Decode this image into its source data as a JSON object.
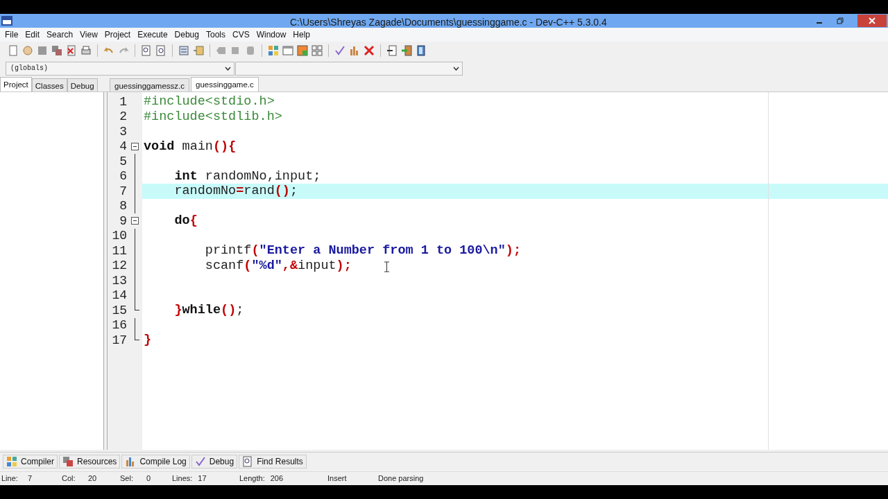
{
  "window": {
    "title": "C:\\Users\\Shreyas Zagade\\Documents\\guessinggame.c - Dev-C++ 5.3.0.4"
  },
  "menu": [
    "File",
    "Edit",
    "Search",
    "View",
    "Project",
    "Execute",
    "Debug",
    "Tools",
    "CVS",
    "Window",
    "Help"
  ],
  "scope_combos": [
    {
      "value": "(globals)"
    }
  ],
  "side_tabs": [
    {
      "label": "Project",
      "selected": true
    },
    {
      "label": "Classes",
      "selected": false
    },
    {
      "label": "Debug",
      "selected": false
    }
  ],
  "file_tabs": [
    {
      "label": "guessinggamessz.c",
      "selected": false
    },
    {
      "label": "guessinggame.c",
      "selected": true
    }
  ],
  "editor": {
    "lines": [
      {
        "number": "1",
        "selected": false,
        "kind": "plain",
        "tokens": [
          {
            "kind": "pre",
            "text": "#include<stdio.h>"
          }
        ]
      },
      {
        "number": "2",
        "selected": false,
        "kind": "plain",
        "tokens": [
          {
            "kind": "pre",
            "text": "#include<stdlib.h>"
          }
        ]
      },
      {
        "number": "3",
        "selected": false,
        "kind": "plain"
      },
      {
        "number": "4",
        "selected": false,
        "kind": "fold_start",
        "tokens": [
          {
            "kind": "kw",
            "text": "void"
          },
          {
            "kind": "id",
            "text": " main"
          },
          {
            "kind": "sym",
            "text": "(){"
          }
        ]
      },
      {
        "number": "5",
        "selected": false,
        "kind": "fold_line"
      },
      {
        "number": "6",
        "selected": false,
        "kind": "fold_line",
        "tokens": [
          {
            "kind": "kw",
            "text": "    int"
          },
          {
            "kind": "id",
            "text": " randomNo,input;"
          }
        ]
      },
      {
        "number": "7",
        "selected": true,
        "kind": "fold_line",
        "tokens": [
          {
            "kind": "id",
            "text": "    randomNo"
          },
          {
            "kind": "sym",
            "text": "="
          },
          {
            "kind": "id",
            "text": "rand"
          },
          {
            "kind": "sym",
            "text": "()"
          },
          {
            "kind": "id",
            "text": ";"
          }
        ]
      },
      {
        "number": "8",
        "selected": false,
        "kind": "fold_line"
      },
      {
        "number": "9",
        "selected": false,
        "kind": "fold_start",
        "tokens": [
          {
            "kind": "kw",
            "text": "    do"
          },
          {
            "kind": "sym",
            "text": "{"
          }
        ]
      },
      {
        "number": "10",
        "selected": false,
        "kind": "fold_line"
      },
      {
        "number": "11",
        "selected": false,
        "kind": "fold_line",
        "tokens": [
          {
            "kind": "id",
            "text": "        printf"
          },
          {
            "kind": "sym",
            "text": "("
          },
          {
            "kind": "str",
            "text": "\"Enter a Number from 1 to 100\\n\""
          },
          {
            "kind": "sym",
            "text": ");"
          }
        ]
      },
      {
        "number": "12",
        "selected": false,
        "kind": "fold_line",
        "tokens": [
          {
            "kind": "id",
            "text": "        scanf"
          },
          {
            "kind": "sym",
            "text": "("
          },
          {
            "kind": "str",
            "text": "\"%d\""
          },
          {
            "kind": "sym",
            "text": ",&"
          },
          {
            "kind": "id",
            "text": "input"
          },
          {
            "kind": "sym",
            "text": ");"
          }
        ]
      },
      {
        "number": "13",
        "selected": false,
        "kind": "fold_line"
      },
      {
        "number": "14",
        "selected": false,
        "kind": "fold_line"
      },
      {
        "number": "15",
        "selected": false,
        "kind": "fold_end",
        "tokens": [
          {
            "kind": "sym",
            "text": "    }"
          },
          {
            "kind": "kw",
            "text": "while"
          },
          {
            "kind": "sym",
            "text": "()"
          },
          {
            "kind": "id",
            "text": ";"
          }
        ]
      },
      {
        "number": "16",
        "selected": false,
        "kind": "fold_line"
      },
      {
        "number": "17",
        "selected": false,
        "kind": "fold_end",
        "tokens": [
          {
            "kind": "sym",
            "text": "}"
          }
        ]
      }
    ]
  },
  "bottom_tabs": [
    "Compiler",
    "Resources",
    "Compile Log",
    "Debug",
    "Find Results"
  ],
  "status_bar": [
    {
      "label": "Line:",
      "value": "7"
    },
    {
      "label": "Col:",
      "value": "20"
    },
    {
      "label": "Sel:",
      "value": "0"
    },
    {
      "label": "Lines:",
      "value": "17"
    },
    {
      "label": "Length:",
      "value": "206"
    },
    {
      "value": "Insert"
    },
    {
      "value": "Done parsing"
    }
  ]
}
